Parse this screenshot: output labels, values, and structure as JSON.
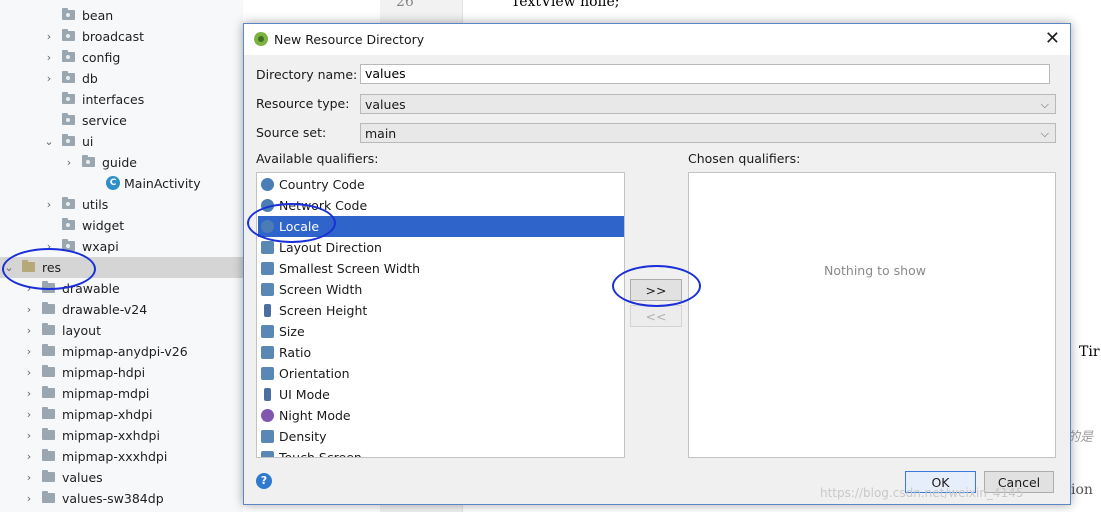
{
  "tree": {
    "items": [
      {
        "label": "bean",
        "chevron": "",
        "kind": "pkg"
      },
      {
        "label": "broadcast",
        "chevron": "›",
        "kind": "pkg"
      },
      {
        "label": "config",
        "chevron": "›",
        "kind": "pkg"
      },
      {
        "label": "db",
        "chevron": "›",
        "kind": "pkg"
      },
      {
        "label": "interfaces",
        "chevron": "",
        "kind": "pkg"
      },
      {
        "label": "service",
        "chevron": "",
        "kind": "pkg"
      },
      {
        "label": "ui",
        "chevron": "⌄",
        "kind": "pkg"
      },
      {
        "label": "guide",
        "chevron": "›",
        "kind": "pkg"
      },
      {
        "label": "MainActivity",
        "chevron": "",
        "kind": "class"
      },
      {
        "label": "utils",
        "chevron": "›",
        "kind": "pkg"
      },
      {
        "label": "widget",
        "chevron": "",
        "kind": "pkg"
      },
      {
        "label": "wxapi",
        "chevron": "›",
        "kind": "pkg"
      },
      {
        "label": "res",
        "chevron": "⌄",
        "kind": "res"
      },
      {
        "label": "drawable",
        "chevron": "›",
        "kind": "folder"
      },
      {
        "label": "drawable-v24",
        "chevron": "›",
        "kind": "folder"
      },
      {
        "label": "layout",
        "chevron": "›",
        "kind": "folder"
      },
      {
        "label": "mipmap-anydpi-v26",
        "chevron": "›",
        "kind": "folder"
      },
      {
        "label": "mipmap-hdpi",
        "chevron": "›",
        "kind": "folder"
      },
      {
        "label": "mipmap-mdpi",
        "chevron": "›",
        "kind": "folder"
      },
      {
        "label": "mipmap-xhdpi",
        "chevron": "›",
        "kind": "folder"
      },
      {
        "label": "mipmap-xxhdpi",
        "chevron": "›",
        "kind": "folder"
      },
      {
        "label": "mipmap-xxxhdpi",
        "chevron": "›",
        "kind": "folder"
      },
      {
        "label": "values",
        "chevron": "›",
        "kind": "folder"
      },
      {
        "label": "values-sw384dp",
        "chevron": "›",
        "kind": "folder"
      }
    ],
    "class_icon_letter": "C"
  },
  "editor": {
    "line_number": "26",
    "code_line": "TextView holle;",
    "right_text": "Tir",
    "right_cjk": "的是",
    "right_bottom": "ion"
  },
  "dialog": {
    "title": "New Resource Directory",
    "directory_name_label": "Directory name:",
    "directory_name_value": "values",
    "resource_type_label": "Resource type:",
    "resource_type_value": "values",
    "source_set_label": "Source set:",
    "source_set_value": "main",
    "available_label": "Available qualifiers:",
    "chosen_label": "Chosen qualifiers:",
    "empty_text": "Nothing to show",
    "add_button": ">>",
    "remove_button": "<<",
    "ok_button": "OK",
    "cancel_button": "Cancel",
    "help_icon": "?",
    "close_icon": "✕",
    "qualifiers": [
      {
        "label": "Country Code",
        "icon": "globe"
      },
      {
        "label": "Network Code",
        "icon": "globe"
      },
      {
        "label": "Locale",
        "icon": "globe"
      },
      {
        "label": "Layout Direction",
        "icon": "square"
      },
      {
        "label": "Smallest Screen Width",
        "icon": "square"
      },
      {
        "label": "Screen Width",
        "icon": "square"
      },
      {
        "label": "Screen Height",
        "icon": "bar"
      },
      {
        "label": "Size",
        "icon": "square"
      },
      {
        "label": "Ratio",
        "icon": "square"
      },
      {
        "label": "Orientation",
        "icon": "square"
      },
      {
        "label": "UI Mode",
        "icon": "bar"
      },
      {
        "label": "Night Mode",
        "icon": "moon"
      },
      {
        "label": "Density",
        "icon": "square"
      },
      {
        "label": "Touch Screen",
        "icon": "square"
      }
    ],
    "selected_index": 2
  },
  "watermark": "https://blog.csdn.net/weixin_4145"
}
